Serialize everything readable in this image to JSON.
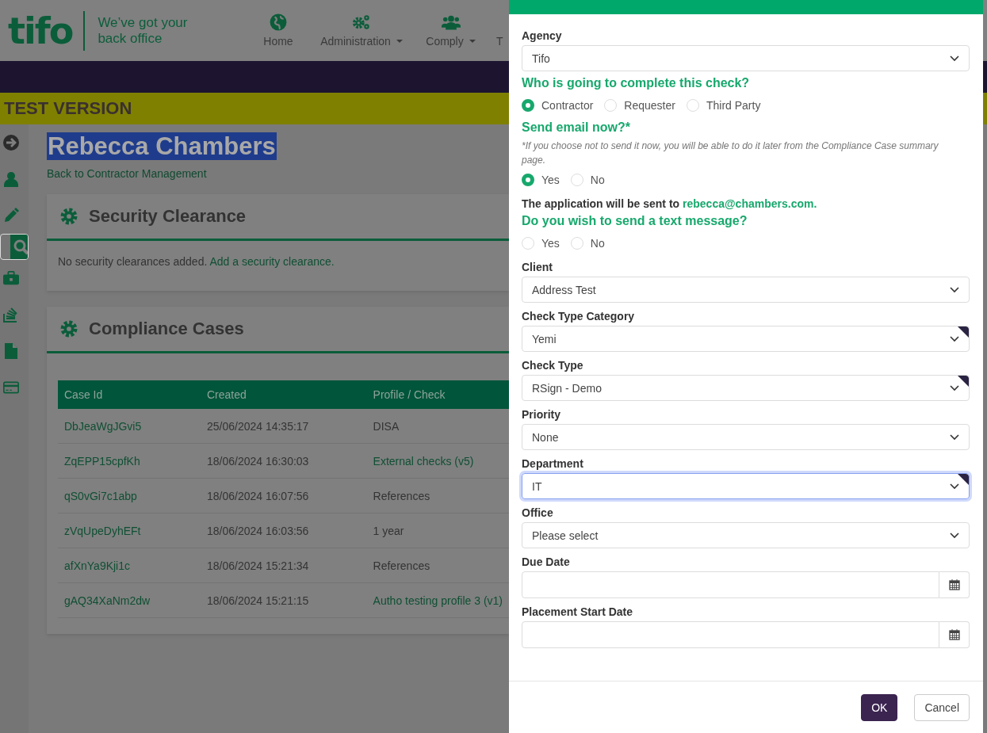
{
  "header": {
    "logo": "tifo",
    "tagline": [
      "We’ve got your",
      "back office"
    ],
    "nav": [
      {
        "label": "Home",
        "dropdown": false
      },
      {
        "label": "Administration",
        "dropdown": true
      },
      {
        "label": "Comply",
        "dropdown": true
      },
      {
        "label": "T",
        "dropdown": false
      }
    ]
  },
  "banner": "TEST VERSION",
  "sidebar": {
    "items": [
      {
        "selected": false
      },
      {
        "selected": false
      },
      {
        "selected": false
      },
      {
        "selected": true
      },
      {
        "selected": false
      },
      {
        "selected": false
      },
      {
        "selected": false
      },
      {
        "selected": false
      }
    ]
  },
  "page": {
    "title": "Rebecca Chambers",
    "title_highlighted": true,
    "back_link": "Back to Contractor Management",
    "security": {
      "heading": "Security Clearance",
      "text": "No security clearances added.",
      "link": "Add a security clearance."
    },
    "compliance": {
      "heading": "Compliance Cases",
      "columns": [
        "Case Id",
        "Created",
        "Profile / Check"
      ],
      "rows": [
        {
          "case_id": "DbJeaWgJGvi5",
          "created": "25/06/2024 14:35:17",
          "profile": "DISA",
          "profile_link": false
        },
        {
          "case_id": "ZqEPP15cpfKh",
          "created": "18/06/2024 16:30:03",
          "profile": "External checks (v5)",
          "profile_link": true
        },
        {
          "case_id": "qS0vGi7c1abp",
          "created": "18/06/2024 16:07:56",
          "profile": "References",
          "profile_link": false
        },
        {
          "case_id": "zVqUpeDyhEFt",
          "created": "18/06/2024 16:03:56",
          "profile": "1 year",
          "profile_link": false
        },
        {
          "case_id": "afXnYa9Kji1c",
          "created": "18/06/2024 15:21:34",
          "profile": "References",
          "profile_link": false
        },
        {
          "case_id": "gAQ34XaNm2dw",
          "created": "18/06/2024 15:21:15",
          "profile": "Autho testing profile 3 (v1)",
          "profile_link": true
        }
      ]
    }
  },
  "panel": {
    "fields": [
      {
        "kind": "select",
        "label": "Agency",
        "value": "Tifo",
        "required": false,
        "focused": false
      },
      {
        "kind": "radio",
        "question": "Who is going to complete this check?",
        "options": [
          {
            "label": "Contractor",
            "selected": true
          },
          {
            "label": "Requester",
            "selected": false
          },
          {
            "label": "Third Party",
            "selected": false
          }
        ]
      },
      {
        "kind": "radio",
        "question": "Send email now?*",
        "note": "*If you choose not to send it now, you will be able to do it later from the Compliance Case summary page.",
        "options": [
          {
            "label": "Yes",
            "selected": true
          },
          {
            "label": "No",
            "selected": false
          }
        ]
      },
      {
        "kind": "info",
        "text": "The application will be sent to",
        "email": "rebecca@chambers.com."
      },
      {
        "kind": "radio",
        "question": "Do you wish to send a text message?",
        "options": [
          {
            "label": "Yes",
            "selected": false
          },
          {
            "label": "No",
            "selected": false
          }
        ]
      },
      {
        "kind": "select",
        "label": "Client",
        "value": "Address Test",
        "required": false,
        "focused": false
      },
      {
        "kind": "select",
        "label": "Check Type Category",
        "value": "Yemi",
        "required": true,
        "focused": false
      },
      {
        "kind": "select",
        "label": "Check Type",
        "value": "RSign - Demo",
        "required": true,
        "focused": false
      },
      {
        "kind": "select",
        "label": "Priority",
        "value": "None",
        "required": false,
        "focused": false
      },
      {
        "kind": "select",
        "label": "Department",
        "value": "IT",
        "required": true,
        "focused": true
      },
      {
        "kind": "select",
        "label": "Office",
        "value": "Please select",
        "required": false,
        "focused": false
      },
      {
        "kind": "date",
        "label": "Due Date"
      },
      {
        "kind": "date",
        "label": "Placement Start Date"
      }
    ],
    "buttons": [
      {
        "label": "OK",
        "primary": true
      },
      {
        "label": "Cancel",
        "primary": false
      }
    ]
  }
}
